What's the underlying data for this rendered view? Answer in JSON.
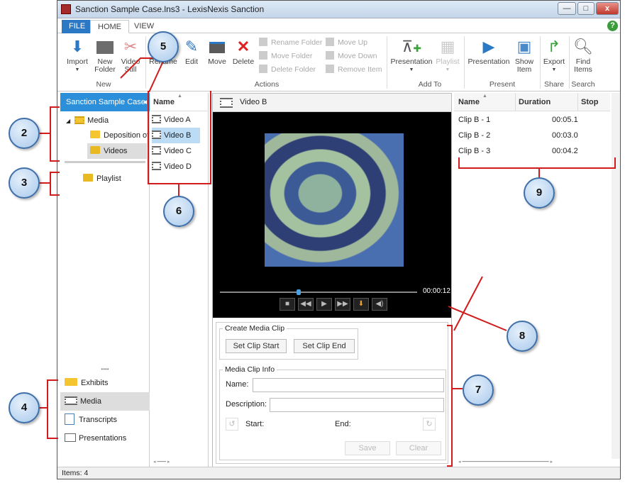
{
  "window": {
    "title": "Sanction Sample Case.lns3 - LexisNexis Sanction",
    "minimize": "—",
    "maximize": "□",
    "close": "x"
  },
  "tabs": {
    "file": "FILE",
    "home": "HOME",
    "view": "VIEW"
  },
  "ribbon": {
    "import": "Import",
    "new_folder_1": "New",
    "new_folder_2": "Folder",
    "video_still_1": "Video",
    "video_still_2": "Still",
    "rename": "Rename",
    "edit": "Edit",
    "move": "Move",
    "delete": "Delete",
    "rename_folder": "Rename Folder",
    "move_folder": "Move Folder",
    "delete_folder": "Delete Folder",
    "move_up": "Move Up",
    "move_down": "Move Down",
    "remove_item": "Remove Item",
    "presentation_add": "Presentation",
    "playlist": "Playlist",
    "presentation": "Presentation",
    "show_item_1": "Show",
    "show_item_2": "Item",
    "export": "Export",
    "find_items_1": "Find",
    "find_items_2": "Items",
    "groups": {
      "new": "New",
      "actions": "Actions",
      "add_to": "Add To",
      "present": "Present",
      "share": "Share",
      "search": "Search"
    }
  },
  "case_panel": {
    "header": "Sanction Sample Case",
    "tree": {
      "media": "Media",
      "deposition": "Deposition of",
      "videos": "Videos",
      "playlist": "Playlist"
    }
  },
  "nav": {
    "exhibits": "Exhibits",
    "media": "Media",
    "transcripts": "Transcripts",
    "presentations": "Presentations"
  },
  "items_list": {
    "header": "Name",
    "items": [
      "Video A",
      "Video B",
      "Video C",
      "Video D"
    ]
  },
  "viewer": {
    "title": "Video B",
    "time": "00:00:12",
    "progress": 0.4
  },
  "clip_create": {
    "legend": "Create Media Clip",
    "set_start": "Set Clip Start",
    "set_end": "Set Clip End"
  },
  "clip_info": {
    "legend": "Media Clip Info",
    "name_label": "Name:",
    "desc_label": "Description:",
    "start_label": "Start:",
    "end_label": "End:",
    "save": "Save",
    "clear": "Clear"
  },
  "clips": {
    "headers": {
      "name": "Name",
      "duration": "Duration",
      "stop": "Stop"
    },
    "rows": [
      {
        "name": "Clip B - 1",
        "duration": "00:05.1"
      },
      {
        "name": "Clip B - 2",
        "duration": "00:03.0"
      },
      {
        "name": "Clip B - 3",
        "duration": "00:04.2"
      }
    ]
  },
  "status": {
    "items": "Items: 4"
  },
  "callouts": {
    "c2": "2",
    "c3": "3",
    "c4": "4",
    "c5": "5",
    "c6": "6",
    "c7": "7",
    "c8": "8",
    "c9": "9"
  }
}
